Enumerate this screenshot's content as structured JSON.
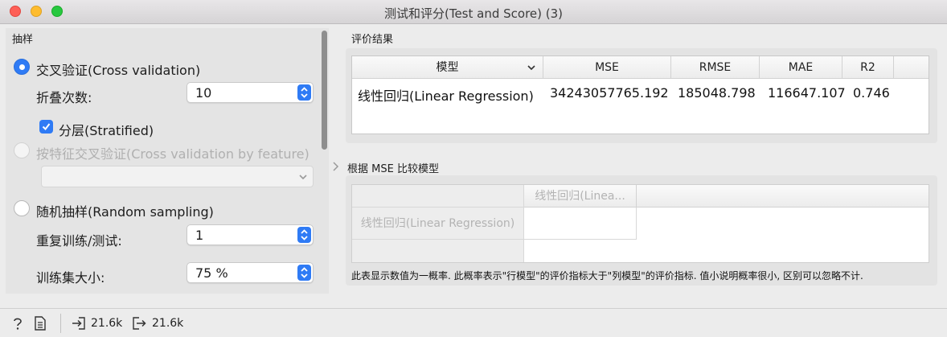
{
  "window": {
    "title": "测试和评分(Test and Score) (3)"
  },
  "sampling": {
    "title": "抽样",
    "cross_validation": {
      "label": "交叉验证(Cross validation)",
      "selected": true,
      "folds_label": "折叠次数:",
      "folds_value": "10",
      "stratified_label": "分层(Stratified)",
      "stratified_checked": true
    },
    "cv_by_feature": {
      "label": "按特征交叉验证(Cross validation by feature)",
      "enabled": false
    },
    "random_sampling": {
      "label": "随机抽样(Random sampling)",
      "selected": false,
      "repeat_label": "重复训练/测试:",
      "repeat_value": "1",
      "train_size_label": "训练集大小:",
      "train_size_value": "75 %"
    }
  },
  "results": {
    "title": "评价结果",
    "columns": [
      "模型",
      "MSE",
      "RMSE",
      "MAE",
      "R2"
    ],
    "rows": [
      {
        "model": "线性回归(Linear Regression)",
        "mse": "34243057765.192",
        "rmse": "185048.798",
        "mae": "116647.107",
        "r2": "0.746"
      }
    ]
  },
  "comparison": {
    "title": "根据 MSE 比较模型",
    "column_header": "线性回归(Linea...",
    "row_header": "线性回归(Linear Regression)",
    "note": "此表显示数值为一概率. 此概率表示\"行模型\"的评价指标大于\"列模型\"的评价指标. 值小说明概率很小, 区别可以忽略不计."
  },
  "statusbar": {
    "input_size": "21.6k",
    "output_size": "21.6k"
  },
  "colors": {
    "accent": "#2f7bf5",
    "close": "#fe5f57",
    "minimize": "#febc2e",
    "zoom": "#28c840"
  }
}
